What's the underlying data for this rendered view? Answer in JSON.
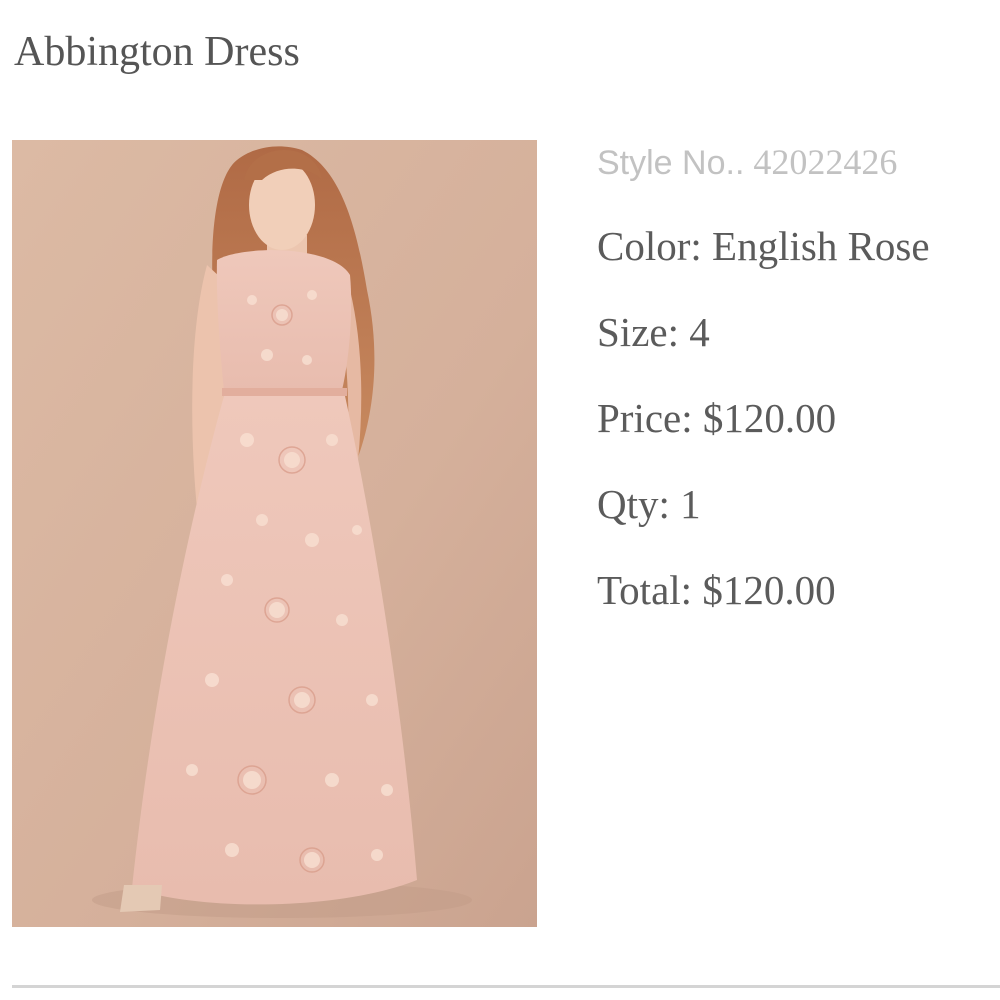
{
  "product": {
    "title": "Abbington Dress",
    "image_alt": "Woman wearing the Abbington Dress in English Rose"
  },
  "details": {
    "style_label": "Style No..",
    "style_number": "42022426",
    "color_label": "Color:",
    "color_value": "English Rose",
    "size_label": "Size:",
    "size_value": "4",
    "price_label": "Price:",
    "price_value": "$120.00",
    "qty_label": "Qty:",
    "qty_value": "1",
    "total_label": "Total:",
    "total_value": "$120.00"
  },
  "colors": {
    "background": "#ffffff",
    "title_text": "#555555",
    "detail_text": "#5b5b5b",
    "muted_text": "#c2c2c2",
    "divider": "#d4d4d4",
    "photo_backdrop": "#d9b6a0",
    "dress": "#ecc1b4"
  }
}
